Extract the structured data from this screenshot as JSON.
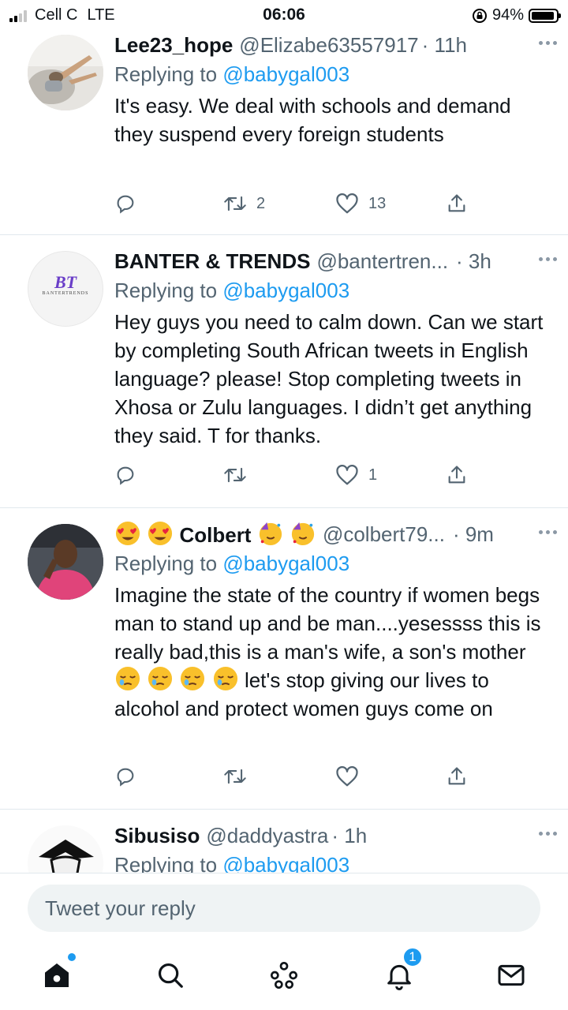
{
  "status_bar": {
    "carrier": "Cell C",
    "network": "LTE",
    "time": "06:06",
    "battery": "94%",
    "battery_level": 0.94
  },
  "reply_prefix": "Replying to ",
  "tweets": [
    {
      "name": "Lee23_hope",
      "handle": "@Elizabe63557917",
      "time": "· 11h",
      "reply_to": "@babygal003",
      "text": "It's easy. We deal with schools and demand they suspend every foreign students",
      "retweets": "2",
      "likes": "13"
    },
    {
      "name": "BANTER & TRENDS",
      "handle": "@bantertren...",
      "time": "· 3h",
      "reply_to": "@babygal003",
      "text": "Hey guys you need to calm down. Can we start by completing South African tweets in English language? please! Stop completing tweets in Xhosa or Zulu languages. I didn’t get anything they said. T for thanks.",
      "retweets": "",
      "likes": "1",
      "avatar_logo": "BT",
      "avatar_subtext": "BANTERTRENDS"
    },
    {
      "name": "Colbert",
      "handle": "@colbert79...",
      "time": "· 9m",
      "reply_to": "@babygal003",
      "text_part1": "Imagine the state of the country if women begs man to stand up and be man....yesessss  this is really bad,this is a man's wife, a son's mother",
      "text_part2": "let's stop giving our lives to alcohol and protect women guys come on",
      "retweets": "",
      "likes": ""
    },
    {
      "name": "Sibusiso",
      "handle": "@daddyastra",
      "time": "· 1h",
      "reply_to": "@babygal003"
    }
  ],
  "reply_bar": {
    "placeholder": "Tweet your reply"
  },
  "nav": {
    "notifications_count": "1",
    "icons": [
      "home-icon",
      "search-icon",
      "spaces-icon",
      "notifications-icon",
      "messages-icon"
    ]
  },
  "colors": {
    "accent": "#1d9bf0",
    "text": "#0f1419",
    "muted": "#536471"
  }
}
